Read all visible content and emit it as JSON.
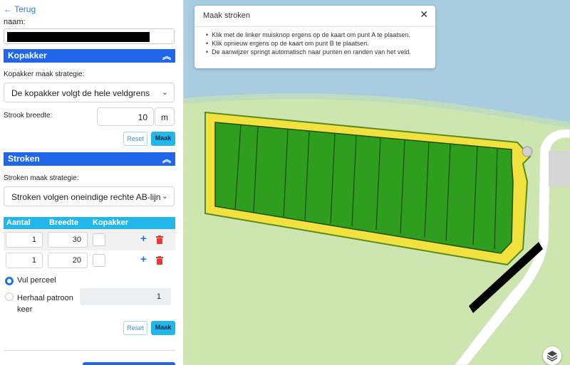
{
  "sidebar": {
    "back_label": "← Terug",
    "name_label": "naam:",
    "kopakker": {
      "header": "Kopakker",
      "strategy_label": "Kopakker maak strategie:",
      "strategy_value": "De kopakker volgt de hele veldgrens",
      "width_label": "Strook breedte:",
      "width_value": "10",
      "width_unit": "m",
      "reset_label": "Reset",
      "maak_label": "Maak"
    },
    "stroken": {
      "header": "Stroken",
      "strategy_label": "Stroken maak strategie:",
      "strategy_value": "Stroken volgen oneindige rechte AB-lijn",
      "columns": [
        "Aantal",
        "Breedte",
        "Kopakker"
      ],
      "rows": [
        {
          "aantal": "1",
          "breedte": "30"
        },
        {
          "aantal": "1",
          "breedte": "20"
        }
      ],
      "vul_perceel": "Vul perceel",
      "herhaal_label": "Herhaal patroon keer",
      "herhaal_value": "1",
      "reset_label": "Reset",
      "maak_label": "Maak"
    }
  },
  "map": {
    "info": {
      "title": "Maak stroken",
      "instructions": [
        "Klik met de linker muisknop ergens op de kaart om punt A te plaatsen.",
        "Klik opnieuw ergens op de kaart om punt B te plaatsen.",
        "De aanwijzer springt automatisch naar punten en randen van het veld."
      ]
    }
  },
  "colors": {
    "section_header": "#1f66ea",
    "table_header": "#22b7e8",
    "field_green": "#2f9e1f",
    "headland_yellow": "#f3e442",
    "water": "#a9cee0",
    "grass": "#cfe8b2"
  }
}
